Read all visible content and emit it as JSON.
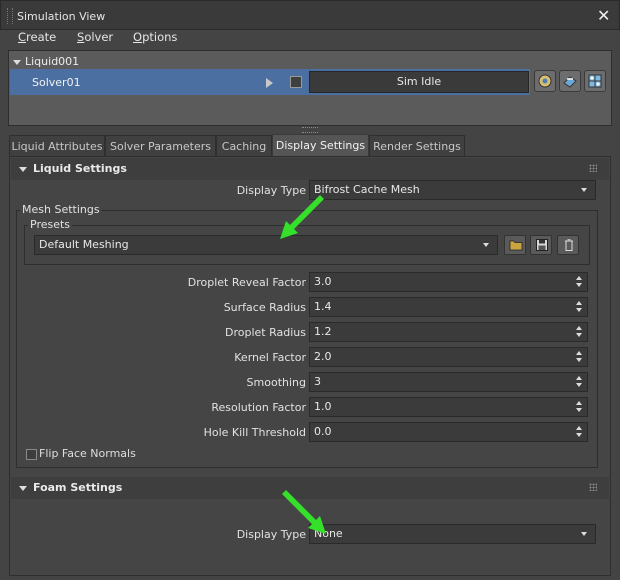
{
  "window": {
    "title": "Simulation View"
  },
  "menu": [
    {
      "label": "Create",
      "u": "C",
      "rest": "reate"
    },
    {
      "label": "Solver",
      "u": "S",
      "rest": "olver"
    },
    {
      "label": "Options",
      "u": "O",
      "rest": "ptions"
    }
  ],
  "tree": {
    "root": "Liquid001",
    "solver": "Solver01",
    "status": "Sim Idle"
  },
  "tabs": [
    "Liquid Attributes",
    "Solver Parameters",
    "Caching",
    "Display Settings",
    "Render Settings"
  ],
  "active_tab": "Display Settings",
  "liquid_settings": {
    "title": "Liquid Settings",
    "display_type_label": "Display Type",
    "display_type_value": "Bifrost Cache Mesh",
    "mesh_settings_label": "Mesh Settings",
    "presets_label": "Presets",
    "preset_value": "Default Meshing",
    "fields": [
      {
        "label": "Droplet Reveal Factor",
        "value": "3.0"
      },
      {
        "label": "Surface Radius",
        "value": "1.4"
      },
      {
        "label": "Droplet Radius",
        "value": "1.2"
      },
      {
        "label": "Kernel Factor",
        "value": "2.0"
      },
      {
        "label": "Smoothing",
        "value": "3"
      },
      {
        "label": "Resolution Factor",
        "value": "1.0"
      },
      {
        "label": "Hole Kill Threshold",
        "value": "0.0"
      }
    ],
    "flip_face_normals": "Flip Face Normals"
  },
  "foam_settings": {
    "title": "Foam Settings",
    "display_type_label": "Display Type",
    "display_type_value": "None"
  },
  "colors": {
    "accent_row": "#4a6fa0",
    "arrow_green": "#35e02a"
  },
  "icons": [
    "close-icon",
    "play-icon",
    "checkbox-icon",
    "solver-tool-icon",
    "mesh-tool-icon",
    "grid-tool-icon",
    "folder-icon",
    "save-icon",
    "delete-icon"
  ]
}
